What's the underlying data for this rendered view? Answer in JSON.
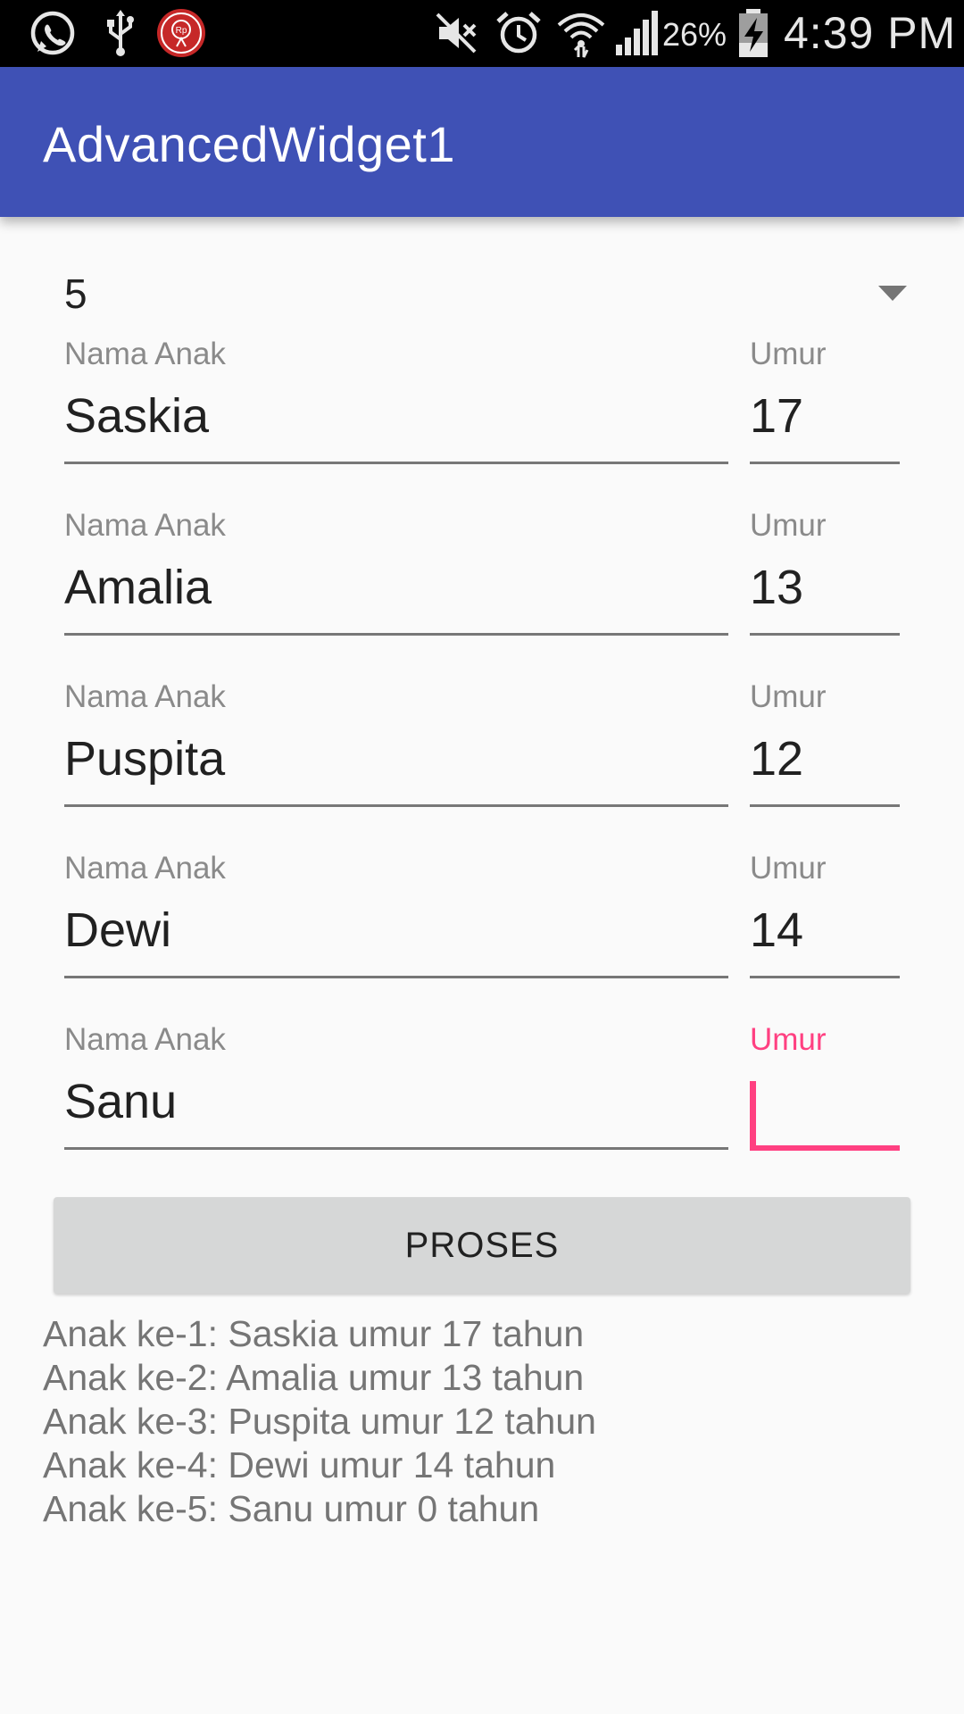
{
  "status_bar": {
    "battery_percent": "26%",
    "time": "4:39 PM",
    "icons": [
      "whatsapp-icon",
      "usb-icon",
      "rp-app-icon",
      "mute-icon",
      "alarm-icon",
      "wifi-icon",
      "signal-icon",
      "battery-charging-icon"
    ]
  },
  "app_bar": {
    "title": "AdvancedWidget1",
    "color": "#3f51b5"
  },
  "spinner": {
    "selected": "5"
  },
  "rows": [
    {
      "name_label": "Nama Anak",
      "name_value": "Saskia",
      "age_label": "Umur",
      "age_value": "17"
    },
    {
      "name_label": "Nama Anak",
      "name_value": "Amalia",
      "age_label": "Umur",
      "age_value": "13"
    },
    {
      "name_label": "Nama Anak",
      "name_value": "Puspita",
      "age_label": "Umur",
      "age_value": "12"
    },
    {
      "name_label": "Nama Anak",
      "name_value": "Dewi",
      "age_label": "Umur",
      "age_value": "14"
    },
    {
      "name_label": "Nama Anak",
      "name_value": "Sanu",
      "age_label": "Umur",
      "age_value": ""
    }
  ],
  "accent_color": "#ff4081",
  "button": {
    "label": "PROSES"
  },
  "result": {
    "lines": [
      "Anak ke-1: Saskia umur 17 tahun",
      "Anak ke-2: Amalia umur 13 tahun",
      "Anak ke-3: Puspita umur 12 tahun",
      "Anak ke-4: Dewi umur 14 tahun",
      "Anak ke-5: Sanu umur 0 tahun"
    ]
  }
}
